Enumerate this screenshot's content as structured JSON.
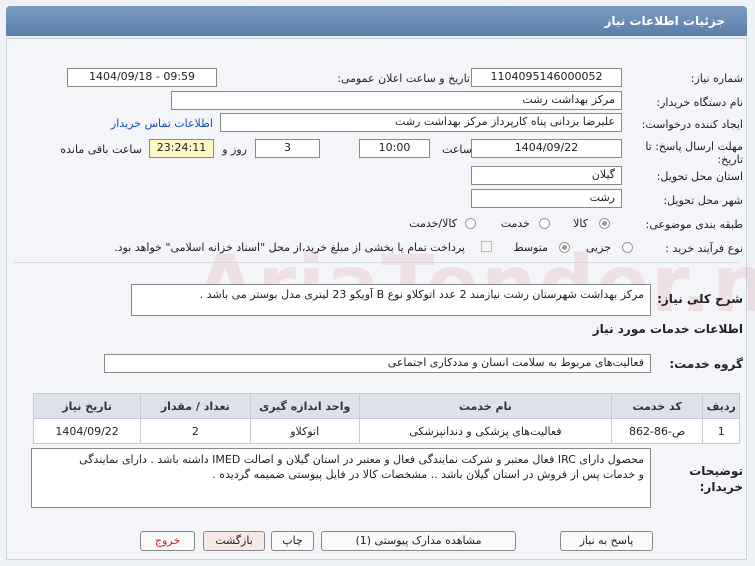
{
  "header": {
    "title": "جزئیات اطلاعات نیاز"
  },
  "fields": {
    "need_number_label": "شماره نیاز:",
    "need_number": "1104095146000052",
    "announce_label": "تاریخ و ساعت اعلان عمومی:",
    "announce_value": "1404/09/18 - 09:59",
    "buyer_label": "نام دستگاه خریدار:",
    "buyer_value": "مرکز بهداشت رشت",
    "creator_label": "ایجاد کننده درخواست:",
    "creator_value": "علیرضا یزدانی پناه کارپرداز مرکز بهداشت رشت",
    "contact_link": "اطلاعات تماس خریدار",
    "deadline_label_1": "مهلت ارسال پاسخ: تا",
    "deadline_label_2": "تاریخ:",
    "deadline_date": "1404/09/22",
    "time_label": "ساعت",
    "deadline_time": "10:00",
    "days_value": "3",
    "days_label": "روز و",
    "remaining_time": "23:24:11",
    "remaining_label": "ساعت باقی مانده",
    "province_label": "استان محل تحویل:",
    "province_value": "گیلان",
    "city_label": "شهر محل تحویل:",
    "city_value": "رشت",
    "category_label": "طبقه بندی موضوعی:",
    "category_options": [
      "کالا",
      "خدمت",
      "کالا/خدمت"
    ],
    "process_label": "نوع فرآیند خرید :",
    "process_options": [
      "جزیی",
      "متوسط"
    ],
    "treasury_note": "پرداخت تمام یا بخشی از مبلغ خرید،از محل \"اسناد خزانه اسلامی\" خواهد بود."
  },
  "description": {
    "label": "شرح کلی نیاز:",
    "value": "مرکز بهداشت شهرستان رشت نیازمند 2 عدد اتوکلاو نوع B  آویکو 23 لیتری مدل بوستر می باشد ."
  },
  "services": {
    "section_title": "اطلاعات خدمات مورد نیاز",
    "group_label": "گروه خدمت:",
    "group_value": "فعالیت‌های مربوط به سلامت انسان و مددکاری اجتماعی",
    "columns": [
      "ردیف",
      "کد خدمت",
      "نام خدمت",
      "واحد اندازه گیری",
      "تعداد / مقدار",
      "تاریخ نیاز"
    ],
    "rows": [
      {
        "row": "1",
        "code": "ص-86-862",
        "name": "فعالیت‌های پزشکی و دندانپزشکی",
        "unit": "اتوکلاو",
        "qty": "2",
        "date": "1404/09/22"
      }
    ]
  },
  "buyer_notes": {
    "label_1": "توضیحات",
    "label_2": "خریدار:",
    "line_1": "محصول دارای IRC فعال معتبر و شرکت نمایندگی فعال و معتبر در استان گیلان و اصالت IMED داشته باشد . دارای نمایندگی",
    "line_2": "و خدمات پس از فروش در استان گیلان باشد .. مشخصات کالا در فایل پیوستی ضمیمه گردیده ."
  },
  "buttons": {
    "reply": "پاسخ به نیاز",
    "attachments": "مشاهده مدارک پیوستی (1)",
    "print": "چاپ",
    "back": "بازگشت",
    "exit": "خروج"
  },
  "colors": {
    "header": "#6a8cb6",
    "accent_link": "#1a4fb0",
    "remaining_bg": "#fff7c4",
    "exit_text": "#cc2222"
  }
}
